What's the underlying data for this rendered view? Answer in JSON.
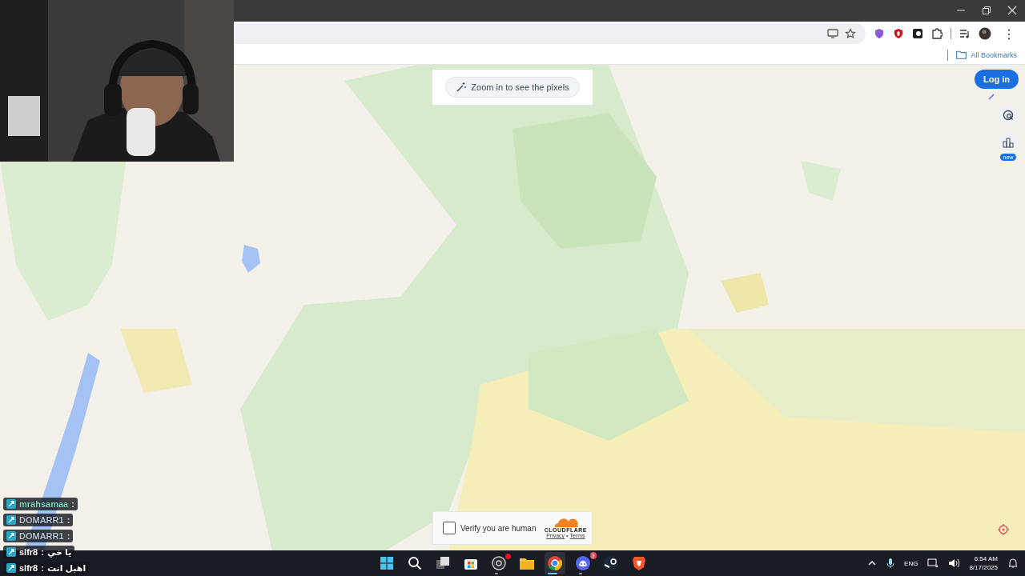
{
  "browser": {
    "bookmarks_folder": "All Bookmarks",
    "menu": "⋮"
  },
  "page": {
    "zoom_hint": "Zoom in to see the pixels",
    "login": "Log in",
    "side_badge": "new",
    "captcha": {
      "checked": false,
      "label": "Verify you are human",
      "brand": "CLOUDFLARE",
      "links": [
        "Privacy",
        "Terms"
      ],
      "separator": "•"
    }
  },
  "stream_chat": {
    "separator": ":",
    "lines": [
      {
        "user": "mrahsamaa",
        "color": "#7fd8c6"
      },
      {
        "user": "DOMARR1",
        "color": "#b9c6d6"
      },
      {
        "user": "DOMARR1",
        "color": "#b9c6d6"
      },
      {
        "user": "slfr8",
        "color": "#ffffff",
        "message": "يا خي"
      },
      {
        "user": "slfr8",
        "color": "#ffffff",
        "message": "اهبل انت"
      }
    ]
  },
  "taskbar": {
    "apps": [
      {
        "kind": "start",
        "running": false,
        "active": false
      },
      {
        "kind": "search",
        "running": false,
        "active": false
      },
      {
        "kind": "taskview",
        "running": false,
        "active": false
      },
      {
        "kind": "store",
        "running": false,
        "active": false
      },
      {
        "kind": "recorder",
        "running": true,
        "active": false,
        "dot": true
      },
      {
        "kind": "folder",
        "running": false,
        "active": false
      },
      {
        "kind": "chrome",
        "running": true,
        "active": true
      },
      {
        "kind": "discord",
        "running": true,
        "active": false,
        "badge": "3"
      },
      {
        "kind": "steam",
        "running": false,
        "active": false
      },
      {
        "kind": "brave",
        "running": false,
        "active": false
      }
    ],
    "language": "ENG",
    "time": "6:54 AM",
    "date": "8/17/2025"
  }
}
